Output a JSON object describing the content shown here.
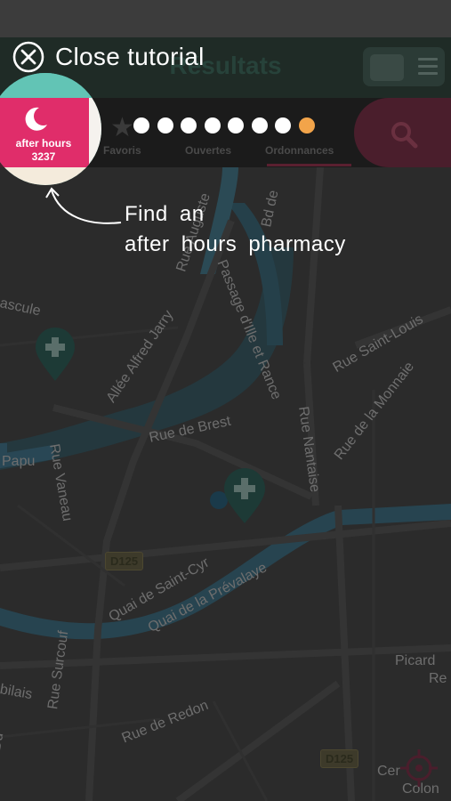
{
  "app": {
    "title": "Résultats"
  },
  "tabs": [
    "Favoris",
    "Ouvertes",
    "Ordonnances"
  ],
  "after_hours": {
    "label": "after hours",
    "number": "3237"
  },
  "tutorial": {
    "close_label": "Close tutorial",
    "hint_line1": "Find  an",
    "hint_line2": "after  hours  pharmacy",
    "total_steps": 8,
    "current_step": 8
  },
  "map": {
    "streets": [
      "Allée Alfred Jarry",
      "Rue Auguste",
      "Passage d'Ille et Rance",
      "Bd de",
      "Rue Saint-Louis",
      "Rue de Brest",
      "Rue Nantaise",
      "Rue de la Monnaie",
      "Rue Vaneau",
      "Papu",
      "ascule",
      "Quai de Saint-Cyr",
      "Quai de la Prévalaye",
      "Rue Surcouf",
      "Rue de Redon",
      "Picard",
      "Re",
      "bilais",
      "Rue Du",
      "Cer",
      "Colon"
    ],
    "road_tags": [
      "D125",
      "D125"
    ]
  },
  "colors": {
    "accent_pink": "#e02d6a",
    "teal": "#62c4b5",
    "active_dot": "#f2a44a"
  }
}
